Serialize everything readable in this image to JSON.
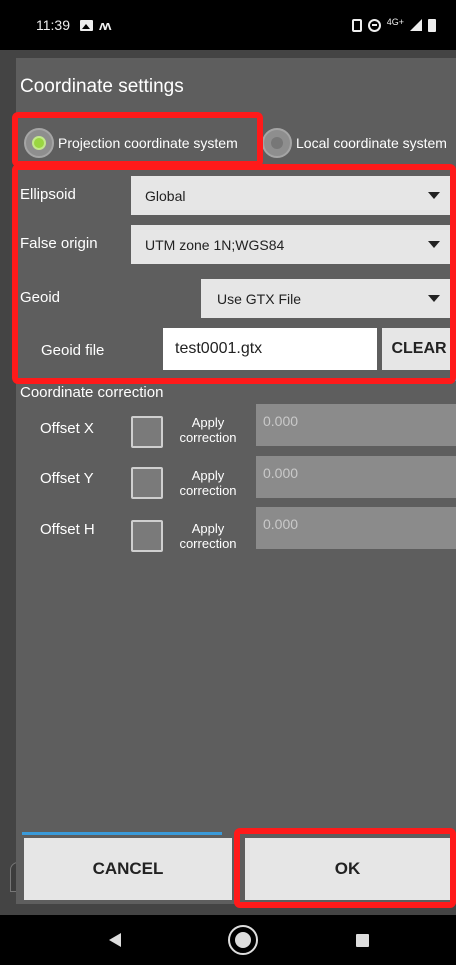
{
  "status_bar": {
    "time": "11:39",
    "network": "4G+",
    "icons": [
      "gallery-icon",
      "m-icon",
      "vibrate-icon",
      "dnd-icon",
      "signal-icon",
      "battery-icon"
    ]
  },
  "dialog": {
    "title": "Coordinate settings",
    "radios": [
      {
        "label": "Projection coordinate system",
        "selected": true
      },
      {
        "label": "Local coordinate system",
        "selected": false
      }
    ],
    "ellipsoid": {
      "label": "Ellipsoid",
      "value": "Global"
    },
    "false_origin": {
      "label": "False origin",
      "value": "UTM zone 1N;WGS84"
    },
    "geoid": {
      "label": "Geoid",
      "value": "Use GTX File"
    },
    "geoid_file": {
      "label": "Geoid file",
      "value": "test0001.gtx",
      "clear_label": "CLEAR"
    },
    "correction": {
      "title": "Coordinate correction",
      "rows": [
        {
          "label": "Offset X",
          "apply_line1": "Apply",
          "apply_line2": "correction",
          "value": "0.000"
        },
        {
          "label": "Offset Y",
          "apply_line1": "Apply",
          "apply_line2": "correction",
          "value": "0.000"
        },
        {
          "label": "Offset H",
          "apply_line1": "Apply",
          "apply_line2": "correction",
          "value": "0.000"
        }
      ]
    },
    "cancel_label": "CANCEL",
    "ok_label": "OK"
  },
  "colors": {
    "highlight": "#ff1a1a",
    "radio_selected": "#9ad641",
    "divider": "#3a9ad9"
  }
}
